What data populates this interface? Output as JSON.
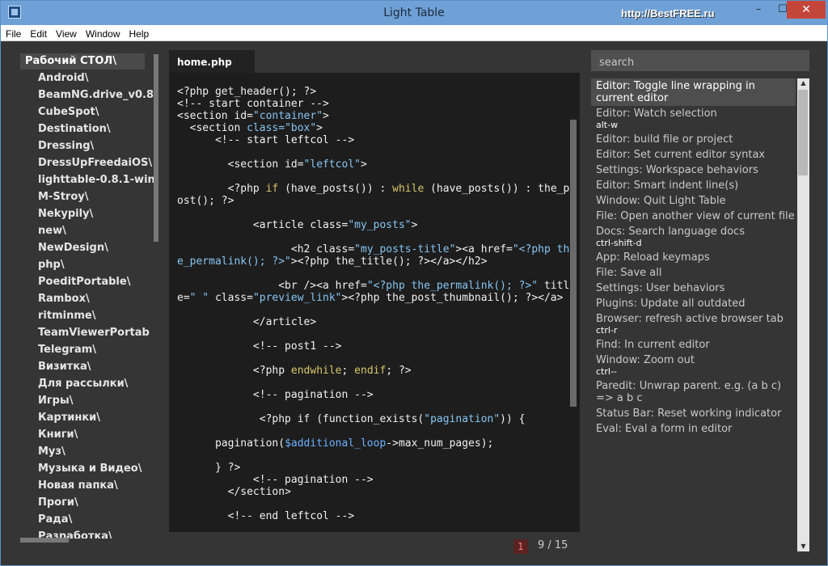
{
  "window": {
    "title": "Light Table",
    "watermark": "http://BestFREE.ru",
    "minimize": "–",
    "maximize": "☐",
    "close": "✕"
  },
  "menu": [
    "File",
    "Edit",
    "View",
    "Window",
    "Help"
  ],
  "sidebar": {
    "root": "Рабочий СТОЛ\\",
    "items": [
      "Android\\",
      "BeamNG.drive_v0.8",
      "CubeSpot\\",
      "Destination\\",
      "Dressing\\",
      "DressUpFreedaiOS\\",
      "lighttable-0.8.1-win",
      "M-Stroy\\",
      "Nekypily\\",
      "new\\",
      "NewDesign\\",
      "php\\",
      "PoeditPortable\\",
      "Rambox\\",
      "ritminme\\",
      "TeamViewerPortab",
      "Telegram\\",
      "Визитка\\",
      "Для рассылки\\",
      "Игры\\",
      "Картинки\\",
      "Книги\\",
      "Муз\\",
      "Музыка и Видео\\",
      "Новая папка\\",
      "Проги\\",
      "Рада\\",
      "Разработка\\"
    ]
  },
  "editor": {
    "tab_label": "home.php",
    "lines": [
      [
        {
          "t": "<?php get_header(); ?>"
        }
      ],
      [
        {
          "t": "<!-- start container -->"
        }
      ],
      [
        {
          "t": "<section id="
        },
        {
          "t": "\"container\"",
          "c": "str"
        },
        {
          "t": ">"
        }
      ],
      [
        {
          "t": "  <section "
        },
        {
          "t": "class=\"box\"",
          "c": "str"
        },
        {
          "t": ">"
        }
      ],
      [
        {
          "t": "      <!-- start leftcol -->"
        }
      ],
      [
        {
          "t": ""
        }
      ],
      [
        {
          "t": "        <section id="
        },
        {
          "t": "\"leftcol\"",
          "c": "str"
        },
        {
          "t": ">"
        }
      ],
      [
        {
          "t": ""
        }
      ],
      [
        {
          "t": "        <?php "
        },
        {
          "t": "if",
          "c": "kw"
        },
        {
          "t": " (have_posts()) : "
        },
        {
          "t": "while",
          "c": "kw"
        },
        {
          "t": " (have_posts()) : the_post(); ?>"
        }
      ],
      [
        {
          "t": ""
        }
      ],
      [
        {
          "t": "            <article class="
        },
        {
          "t": "\"my_posts\"",
          "c": "str"
        },
        {
          "t": ">"
        }
      ],
      [
        {
          "t": ""
        }
      ],
      [
        {
          "t": "                  <h2 class="
        },
        {
          "t": "\"my_posts-title\"",
          "c": "str"
        },
        {
          "t": "><a href="
        },
        {
          "t": "\"<?php the_permalink(); ?>\"",
          "c": "str"
        },
        {
          "t": "><?php the_title(); ?></a></h2>"
        }
      ],
      [
        {
          "t": ""
        }
      ],
      [
        {
          "t": "                <br /><a href="
        },
        {
          "t": "\"<?php the_permalink(); ?>\"",
          "c": "str"
        },
        {
          "t": " title="
        },
        {
          "t": "\" \"",
          "c": "str"
        },
        {
          "t": " class="
        },
        {
          "t": "\"preview_link\"",
          "c": "str"
        },
        {
          "t": "><?php the_post_thumbnail(); ?></a>"
        }
      ],
      [
        {
          "t": ""
        }
      ],
      [
        {
          "t": "            </article>"
        }
      ],
      [
        {
          "t": ""
        }
      ],
      [
        {
          "t": "            <!-- post1 -->"
        }
      ],
      [
        {
          "t": ""
        }
      ],
      [
        {
          "t": "            <?php "
        },
        {
          "t": "endwhile",
          "c": "kw"
        },
        {
          "t": "; "
        },
        {
          "t": "endif",
          "c": "kw"
        },
        {
          "t": "; ?>"
        }
      ],
      [
        {
          "t": ""
        }
      ],
      [
        {
          "t": "            <!-- pagination -->"
        }
      ],
      [
        {
          "t": ""
        }
      ],
      [
        {
          "t": "             <?php if (function_exists("
        },
        {
          "t": "\"pagination\"",
          "c": "str"
        },
        {
          "t": ")) {"
        }
      ],
      [
        {
          "t": ""
        }
      ],
      [
        {
          "t": "      pagination("
        },
        {
          "t": "$additional_loop",
          "c": "var"
        },
        {
          "t": "->max_num_pages);"
        }
      ],
      [
        {
          "t": ""
        }
      ],
      [
        {
          "t": "      } ?>"
        }
      ],
      [
        {
          "t": "            <!-- pagination -->"
        }
      ],
      [
        {
          "t": "        </section>"
        }
      ],
      [
        {
          "t": ""
        }
      ],
      [
        {
          "t": "        <!-- end leftcol -->"
        }
      ]
    ],
    "error_count": "1",
    "position": "9 / 15"
  },
  "commands": {
    "search_placeholder": "search",
    "items": [
      {
        "name": "Editor: Toggle line wrapping in current editor",
        "binding": "",
        "selected": true
      },
      {
        "name": "Editor: Watch selection",
        "binding": "alt-w"
      },
      {
        "name": "Editor: build file or project",
        "binding": ""
      },
      {
        "name": "Editor: Set current editor syntax",
        "binding": ""
      },
      {
        "name": "Settings: Workspace behaviors",
        "binding": ""
      },
      {
        "name": "Editor: Smart indent line(s)",
        "binding": ""
      },
      {
        "name": "Window: Quit Light Table",
        "binding": ""
      },
      {
        "name": "File: Open another view of current file",
        "binding": ""
      },
      {
        "name": "Docs: Search language docs",
        "binding": "ctrl-shift-d"
      },
      {
        "name": "App: Reload keymaps",
        "binding": ""
      },
      {
        "name": "File: Save all",
        "binding": ""
      },
      {
        "name": "Settings: User behaviors",
        "binding": ""
      },
      {
        "name": "Plugins: Update all outdated",
        "binding": ""
      },
      {
        "name": "Browser: refresh active browser tab",
        "binding": "ctrl-r"
      },
      {
        "name": "Find: In current editor",
        "binding": ""
      },
      {
        "name": "Window: Zoom out",
        "binding": "ctrl--"
      },
      {
        "name": "Paredit: Unwrap parent. e.g. (a b c) => a b c",
        "binding": ""
      },
      {
        "name": "Status Bar: Reset working indicator",
        "binding": ""
      },
      {
        "name": "Eval: Eval a form in editor",
        "binding": ""
      }
    ]
  }
}
